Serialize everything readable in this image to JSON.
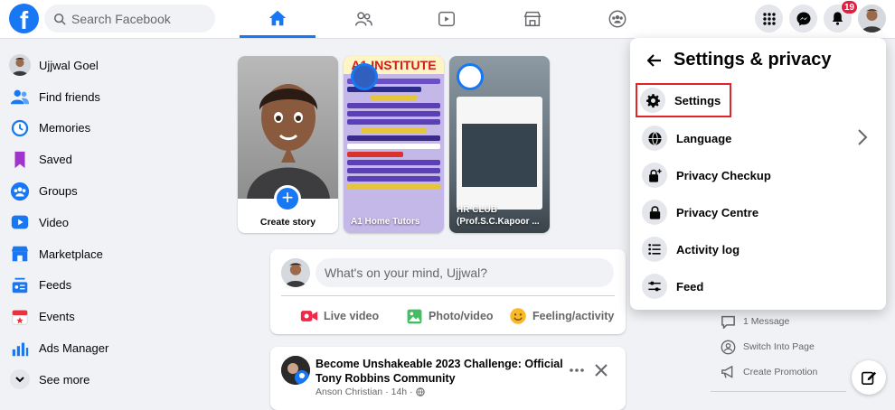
{
  "topbar": {
    "logo": "f",
    "search_placeholder": "Search Facebook",
    "notification_count": "19"
  },
  "sidebar": {
    "items": [
      {
        "label": "Ujjwal Goel",
        "icon": "profile-avatar"
      },
      {
        "label": "Find friends",
        "icon": "friends-icon"
      },
      {
        "label": "Memories",
        "icon": "clock-icon"
      },
      {
        "label": "Saved",
        "icon": "bookmark-icon"
      },
      {
        "label": "Groups",
        "icon": "groups-icon"
      },
      {
        "label": "Video",
        "icon": "video-icon"
      },
      {
        "label": "Marketplace",
        "icon": "shop-icon"
      },
      {
        "label": "Feeds",
        "icon": "feeds-icon"
      },
      {
        "label": "Events",
        "icon": "calendar-icon"
      },
      {
        "label": "Ads Manager",
        "icon": "bar-chart-icon"
      },
      {
        "label": "See more",
        "icon": "chevron-down-icon"
      }
    ]
  },
  "stories": {
    "create_label": "Create story",
    "items": [
      {
        "name": "A1 Home Tutors",
        "header": "A1 INSTITUTE"
      },
      {
        "name": "HR CLUB (Prof.S.C.Kapoor ...",
        "header": ""
      }
    ]
  },
  "composer": {
    "placeholder": "What's on your mind, Ujjwal?",
    "actions": [
      "Live video",
      "Photo/video",
      "Feeling/activity"
    ]
  },
  "post": {
    "title": "Become Unshakeable 2023 Challenge: Official Tony Robbins Community",
    "author": "Anson Christian",
    "time": "14h"
  },
  "right_column": {
    "items": [
      "1 Message",
      "Switch Into Page",
      "Create Promotion"
    ]
  },
  "settings_menu": {
    "title": "Settings & privacy",
    "items": [
      {
        "label": "Settings",
        "icon": "gear-icon"
      },
      {
        "label": "Language",
        "icon": "globe-icon"
      },
      {
        "label": "Privacy Checkup",
        "icon": "lock-plus-icon"
      },
      {
        "label": "Privacy Centre",
        "icon": "lock-icon"
      },
      {
        "label": "Activity log",
        "icon": "list-icon"
      },
      {
        "label": "Feed",
        "icon": "sliders-icon"
      }
    ]
  },
  "colors": {
    "brand": "#1877f2",
    "highlight_box": "#e0242a",
    "badge": "#e41e3f"
  }
}
